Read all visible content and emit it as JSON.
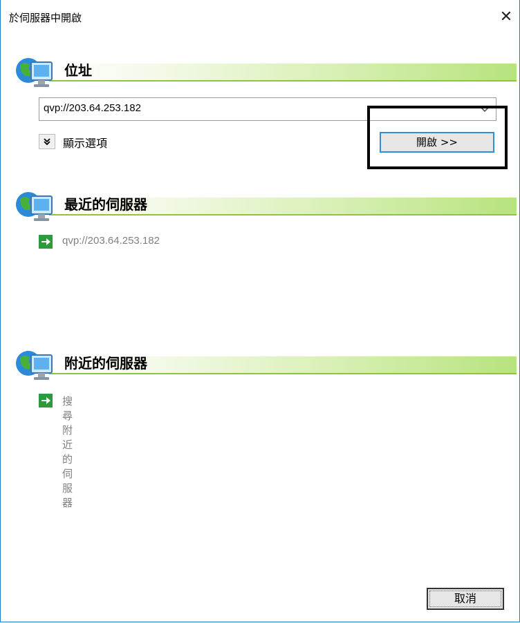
{
  "window": {
    "title": "於伺服器中開啟",
    "close_glyph": "✕"
  },
  "address": {
    "heading": "位址",
    "value": "qvp://203.64.253.182",
    "show_options_label": "顯示選項",
    "open_button_label": "開啟 >>"
  },
  "recent": {
    "heading": "最近的伺服器",
    "items": [
      {
        "label": "qvp://203.64.253.182"
      }
    ]
  },
  "nearby": {
    "heading": "附近的伺服器",
    "items": [
      {
        "label": "搜尋附近的伺服器"
      }
    ]
  },
  "footer": {
    "cancel_label": "取消"
  },
  "colors": {
    "accent": "#2f8fd6",
    "green": "#8cc63f",
    "link_gray": "#808080"
  },
  "icons": {
    "header": "globe-monitor-icon",
    "entry": "green-arrow-icon",
    "expand": "double-chevron-down-icon",
    "combo": "chevron-down-icon"
  }
}
